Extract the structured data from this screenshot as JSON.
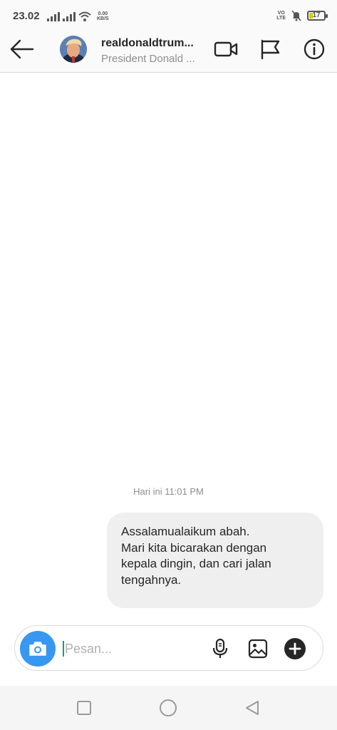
{
  "status_bar": {
    "time": "23.02",
    "net_speed_value": "0.00",
    "net_speed_unit": "KB/S",
    "volte_top": "VO",
    "volte_bottom": "LTE",
    "battery": "17"
  },
  "header": {
    "username": "realdonaldtrum...",
    "subtitle": "President Donald ...",
    "icons": [
      "back-arrow-icon",
      "video-call-icon",
      "flag-icon",
      "info-icon"
    ]
  },
  "chat": {
    "timestamp": "Hari ini 11:01 PM",
    "messages": [
      {
        "from": "me",
        "text": "Assalamualaikum abah.\nMari kita bicarakan dengan\nkepala dingin, dan cari jalan\ntengahnya."
      }
    ]
  },
  "composer": {
    "placeholder": "Pesan...",
    "value": "",
    "icons": [
      "camera-icon",
      "microphone-icon",
      "gallery-icon",
      "plus-icon"
    ]
  },
  "colors": {
    "accent": "#3897f0",
    "bubble": "#efefef",
    "muted_text": "#8e8e8e"
  }
}
